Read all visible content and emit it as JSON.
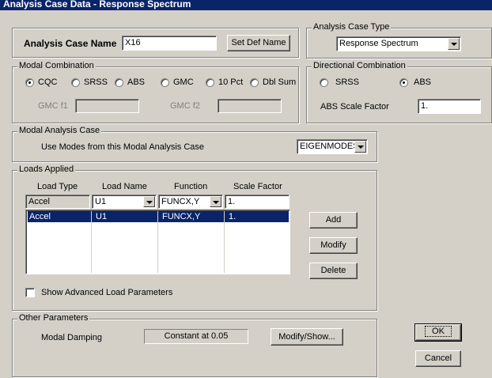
{
  "window": {
    "title": "Analysis Case Data - Response Spectrum"
  },
  "case_name": {
    "label": "Analysis Case Name",
    "value": "X16",
    "set_def_button": "Set Def Name"
  },
  "case_type": {
    "legend": "Analysis Case Type",
    "selected": "Response Spectrum"
  },
  "modal_combination": {
    "legend": "Modal Combination",
    "options": [
      {
        "label": "CQC",
        "checked": true
      },
      {
        "label": "SRSS",
        "checked": false
      },
      {
        "label": "ABS",
        "checked": false
      },
      {
        "label": "GMC",
        "checked": false
      },
      {
        "label": "10 Pct",
        "checked": false
      },
      {
        "label": "Dbl Sum",
        "checked": false
      }
    ],
    "gmc_f1_label": "GMC f1",
    "gmc_f2_label": "GMC f2",
    "gmc_f1_value": "",
    "gmc_f2_value": ""
  },
  "directional_combination": {
    "legend": "Directional Combination",
    "options": [
      {
        "label": "SRSS",
        "checked": false
      },
      {
        "label": "ABS",
        "checked": true
      }
    ],
    "scale_label": "ABS Scale Factor",
    "scale_value": "1."
  },
  "modal_analysis_case": {
    "legend": "Modal Analysis Case",
    "label": "Use Modes from this Modal Analysis Case",
    "selected": "EIGENMODES"
  },
  "loads_applied": {
    "legend": "Loads Applied",
    "headers": [
      "Load Type",
      "Load Name",
      "Function",
      "Scale Factor"
    ],
    "edit_row": {
      "load_type": "Accel",
      "load_name": "U1",
      "function": "FUNCX,Y",
      "scale": "1."
    },
    "rows": [
      {
        "load_type": "Accel",
        "load_name": "U1",
        "function": "FUNCX,Y",
        "scale": "1."
      }
    ],
    "add_button": "Add",
    "modify_button": "Modify",
    "delete_button": "Delete",
    "advanced_label": "Show Advanced Load Parameters",
    "advanced_checked": false
  },
  "other_parameters": {
    "legend": "Other Parameters",
    "damping_label": "Modal Damping",
    "damping_value": "Constant at 0.05",
    "modify_show_button": "Modify/Show..."
  },
  "dialog_buttons": {
    "ok": "OK",
    "cancel": "Cancel"
  },
  "colors": {
    "titlebar": "#0a246a",
    "face": "#d4d0c8",
    "selection": "#0a246a"
  }
}
